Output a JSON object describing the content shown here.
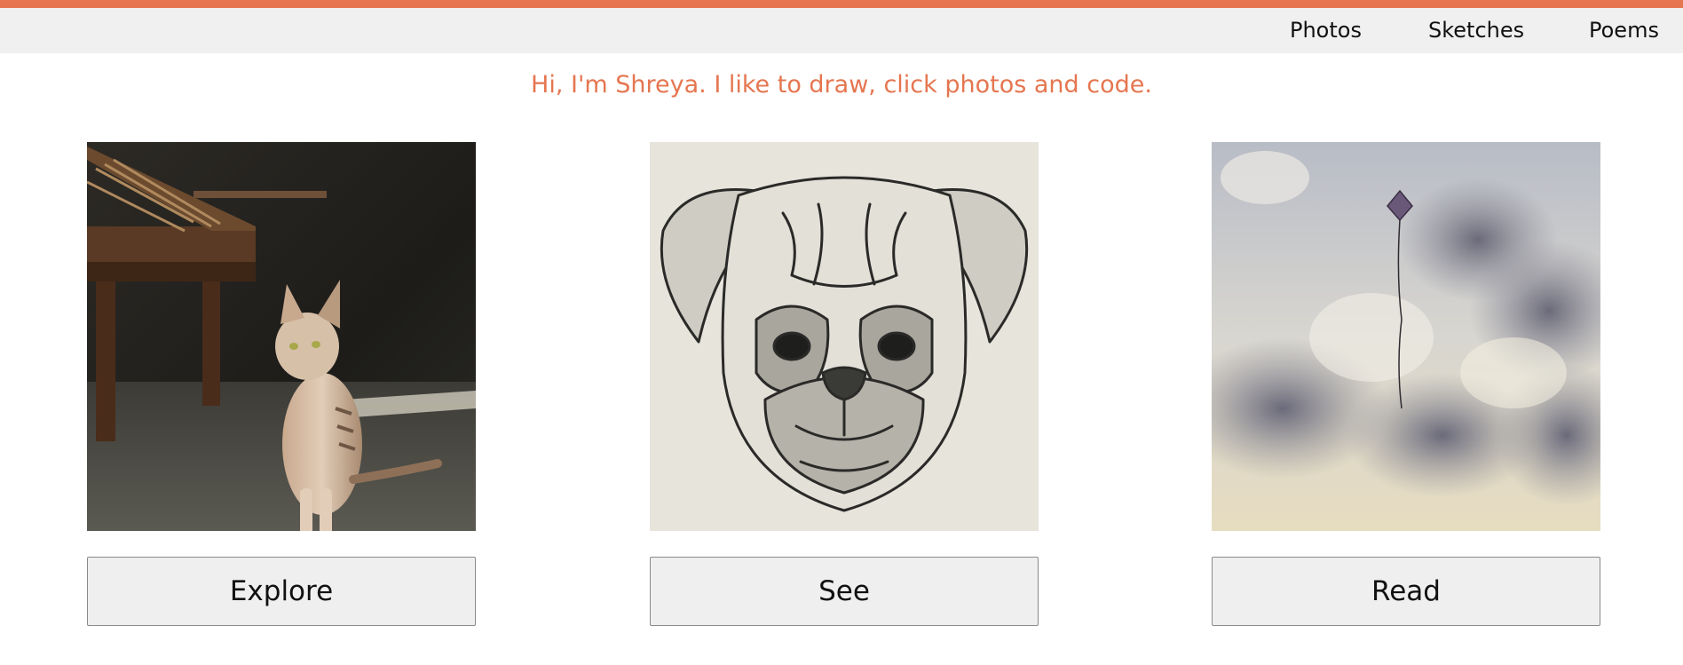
{
  "nav": {
    "items": [
      {
        "label": "Photos"
      },
      {
        "label": "Sketches"
      },
      {
        "label": "Poems"
      }
    ]
  },
  "tagline": "Hi, I'm Shreya. I like to draw, click photos and code.",
  "cards": [
    {
      "image": "cat-by-piano-photo",
      "button_label": "Explore"
    },
    {
      "image": "pug-face-sketch",
      "button_label": "See"
    },
    {
      "image": "kite-in-cloudy-sky-photo",
      "button_label": "Read"
    }
  ],
  "colors": {
    "accent": "#e57650",
    "navbar_bg": "#f0f0f0",
    "button_bg": "#efefef",
    "button_border": "#8a8a8a"
  }
}
